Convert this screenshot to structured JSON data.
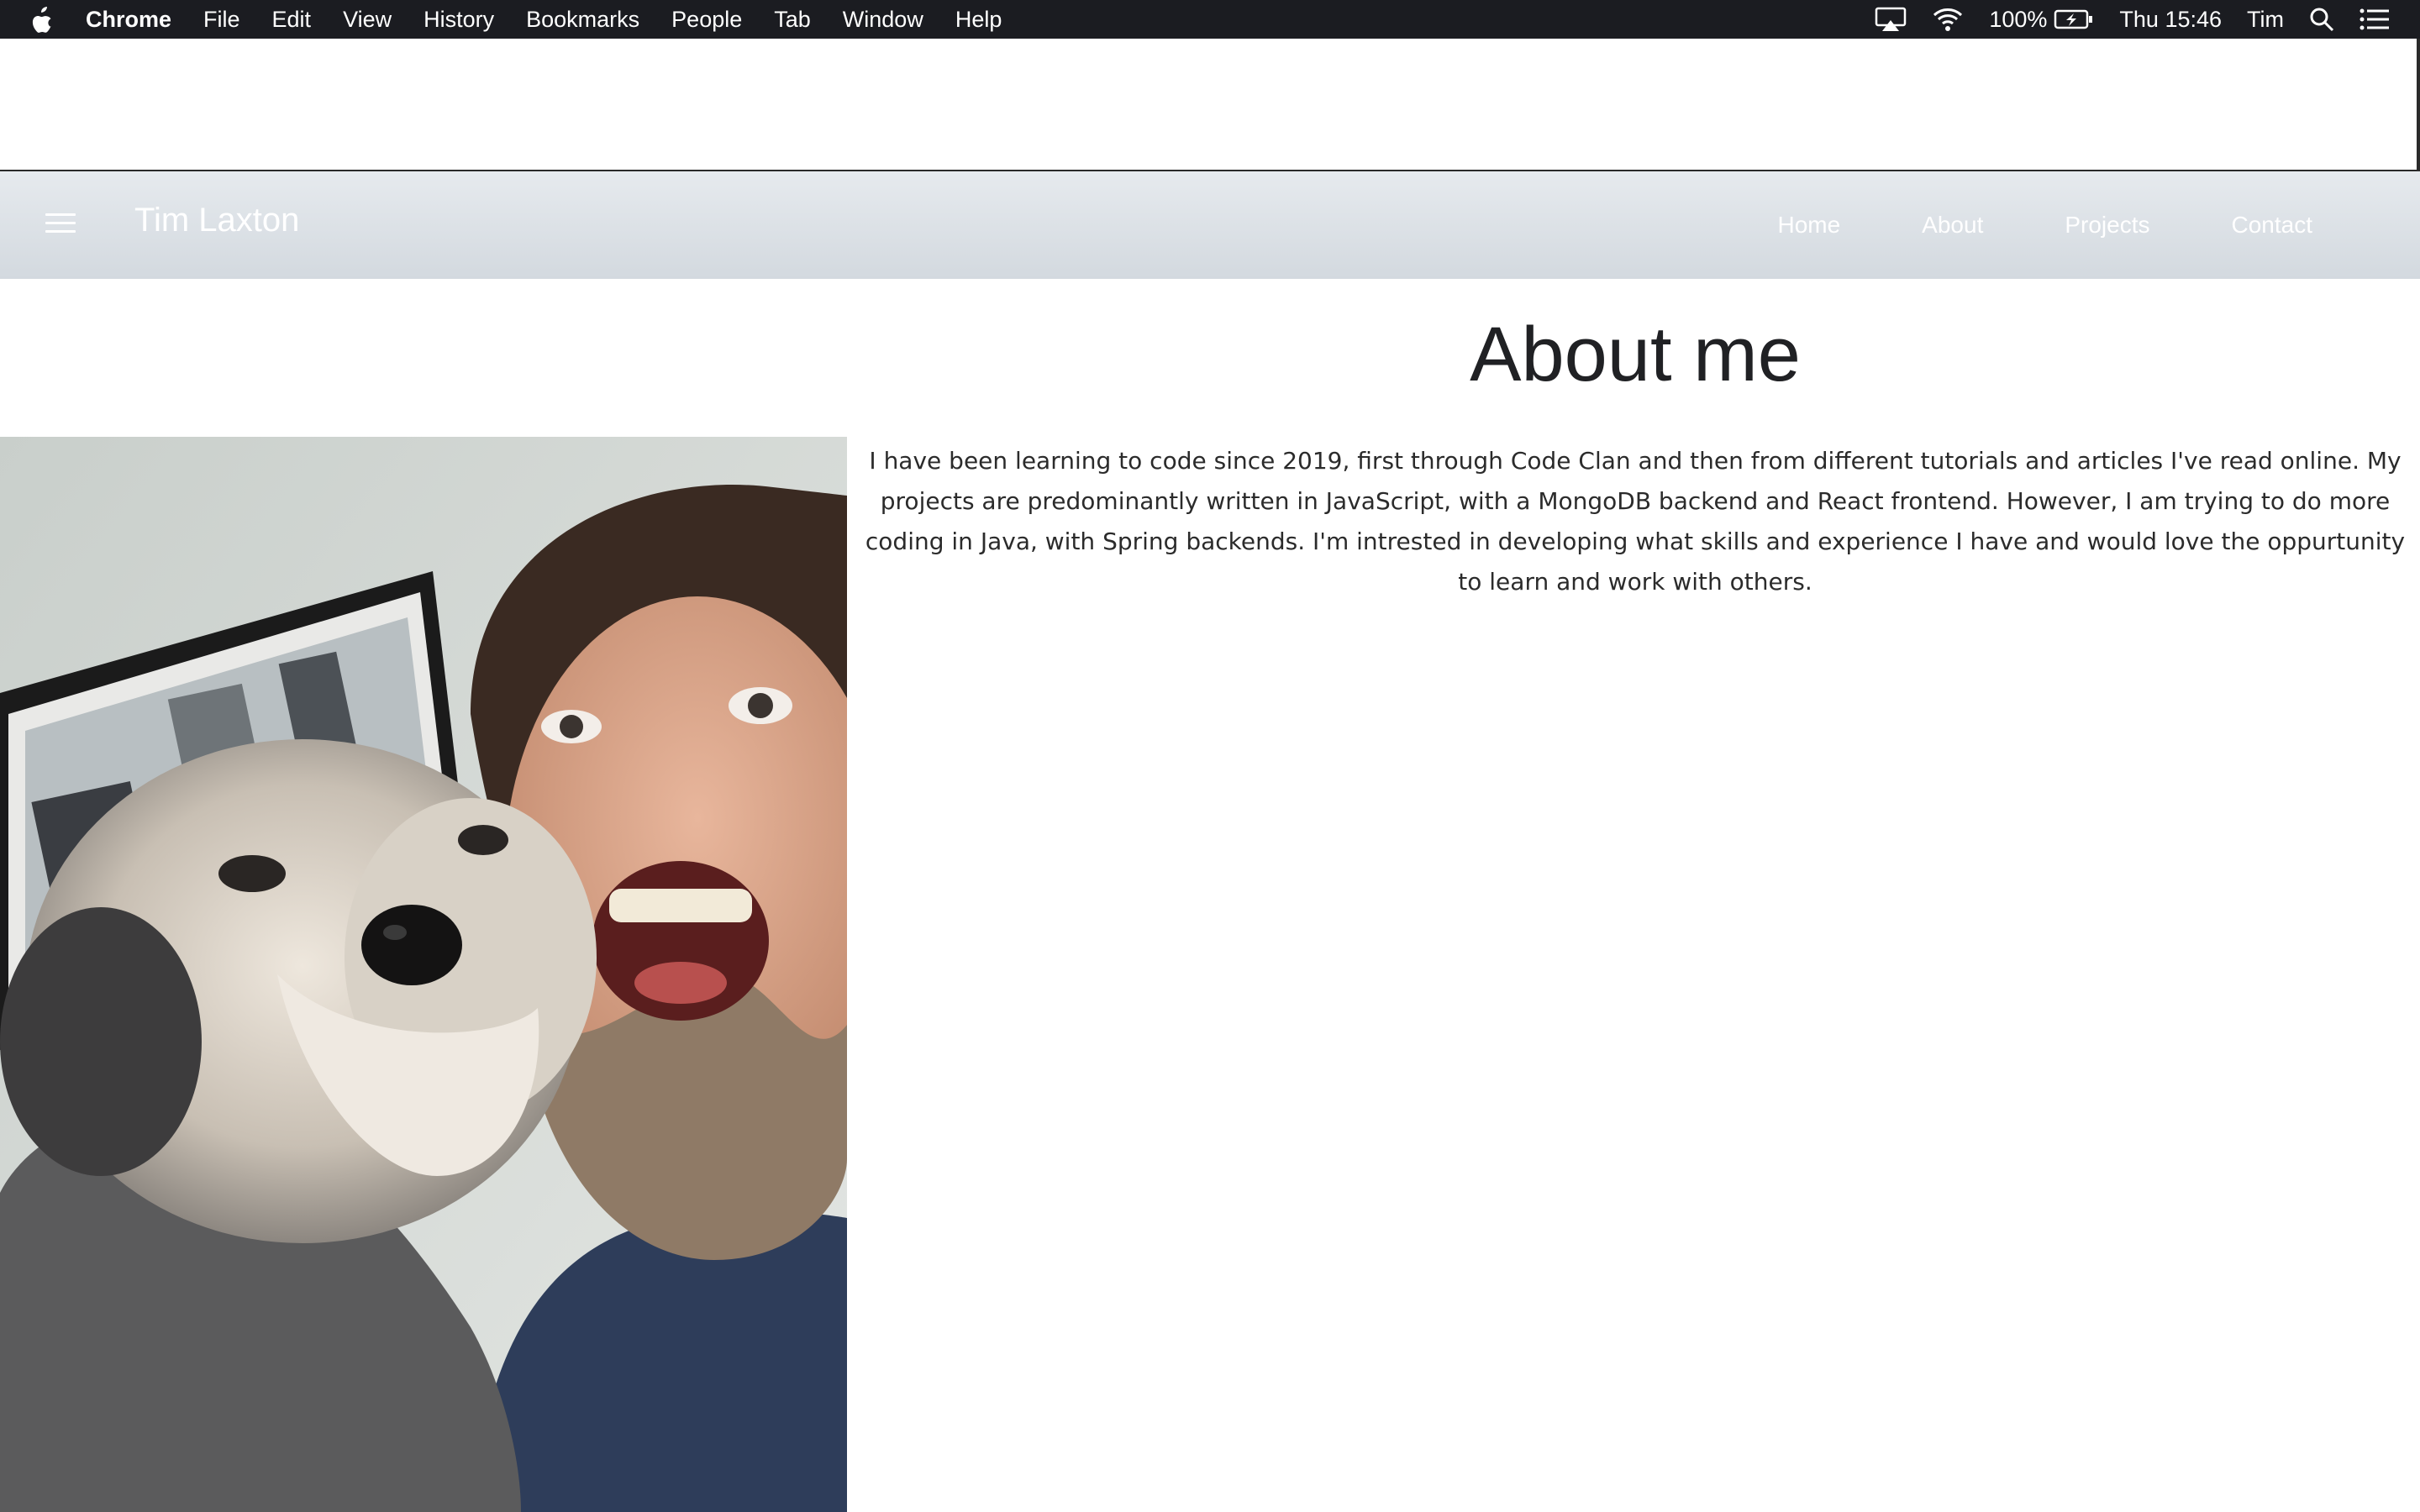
{
  "menubar": {
    "app_name": "Chrome",
    "items": [
      "File",
      "Edit",
      "View",
      "History",
      "Bookmarks",
      "People",
      "Tab",
      "Window",
      "Help"
    ],
    "battery": "100%",
    "clock": "Thu 15:46",
    "user": "Tim",
    "icons": [
      "apple-icon",
      "airplay-icon",
      "wifi-icon",
      "battery-icon",
      "search-icon",
      "list-icon"
    ]
  },
  "navbar": {
    "brand": "Tim Laxton",
    "links": [
      "Home",
      "About",
      "Projects",
      "Contact"
    ],
    "menu_icon": "hamburger-icon"
  },
  "about": {
    "heading": "About me",
    "bio": "I have been learning to code since 2019, first through Code Clan and then from different tutorials and articles I've read online. My projects are predominantly written in JavaScript, with a MongoDB backend and React frontend. However, I am trying to do more coding in Java, with Spring backends. I'm intrested in developing what skills and experience I have and would love the oppurtunity to learn and work with others."
  },
  "colors": {
    "menubar_bg": "#1b1c21",
    "navbar_bg": "#dde2e7",
    "text": "#202124"
  }
}
